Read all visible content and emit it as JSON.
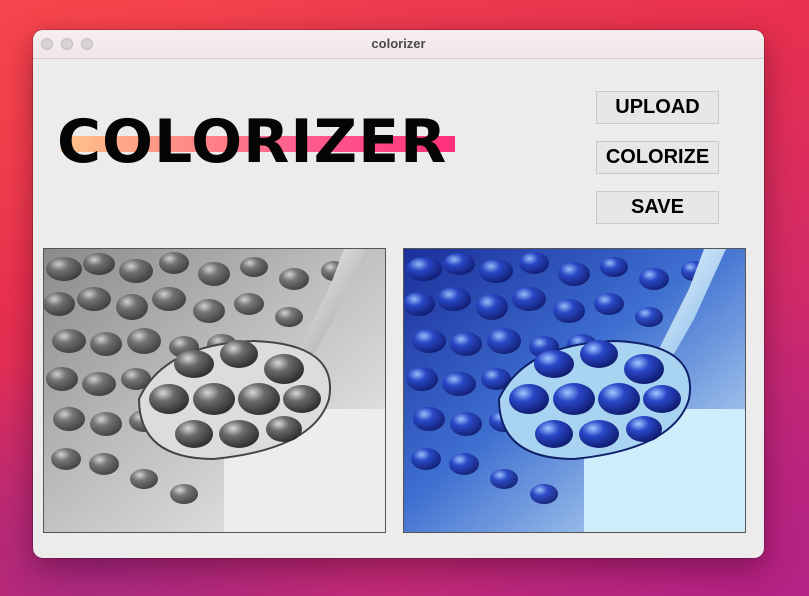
{
  "window": {
    "title": "colorizer"
  },
  "logo": {
    "text": "COLORIZER",
    "gradient_colors": [
      "#ffc48a",
      "#ff8e85",
      "#ff5e8f",
      "#ff2f7a"
    ]
  },
  "buttons": {
    "upload": "UPLOAD",
    "colorize": "COLORIZE",
    "save": "SAVE"
  },
  "images": {
    "original": {
      "tone": "grayscale",
      "subject": "pomegranate-seeds-on-spoon"
    },
    "colorized": {
      "tone": "blue-tinted",
      "subject": "pomegranate-seeds-on-spoon"
    }
  },
  "colors": {
    "desktop": [
      "#f2454e",
      "#d12a68",
      "#b42a86"
    ],
    "window_bg": "#ececec"
  }
}
